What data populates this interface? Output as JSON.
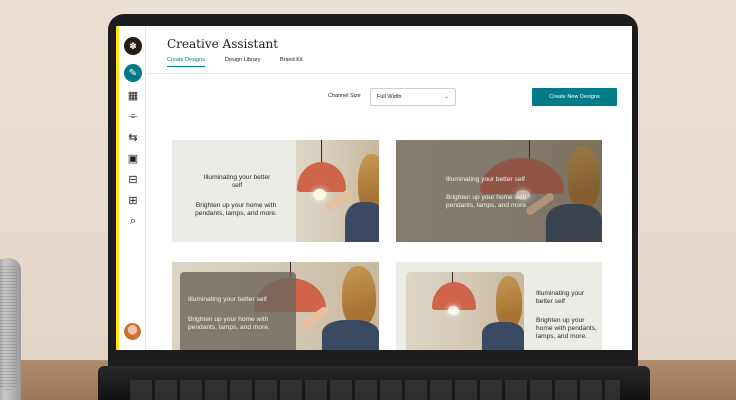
{
  "app": {
    "title": "Creative Assistant",
    "logo_glyph": "✽"
  },
  "tabs": [
    {
      "label": "Create Designs",
      "active": true
    },
    {
      "label": "Design Library",
      "active": false
    },
    {
      "label": "Brand Kit",
      "active": false
    }
  ],
  "controls": {
    "channel_size_label": "Channel Size",
    "channel_size_value": "Full Width",
    "create_button_label": "Create New Designs"
  },
  "sidebar_icons": [
    {
      "name": "pencil-icon",
      "glyph": "✎",
      "active": true
    },
    {
      "name": "campaigns-icon",
      "glyph": "▦"
    },
    {
      "name": "tag-icon",
      "glyph": "⌯"
    },
    {
      "name": "automation-icon",
      "glyph": "⇆"
    },
    {
      "name": "calendar-icon",
      "glyph": "▣"
    },
    {
      "name": "content-icon",
      "glyph": "⊟"
    },
    {
      "name": "grid-icon",
      "glyph": "⊞"
    },
    {
      "name": "search-icon",
      "glyph": "⌕"
    }
  ],
  "designs": [
    {
      "headline": "Illuminating your better self",
      "body": "Brighten up your home with pendants, lamps, and more."
    },
    {
      "headline": "Illuminating your better self",
      "body": "Brighten up your home with pendants, lamps, and more."
    },
    {
      "headline": "Illuminating your better self",
      "body": "Brighten up your home with pendants, lamps, and more."
    },
    {
      "headline": "Illuminating your better self",
      "body": "Brighten up your home with pendants, lamps, and more."
    }
  ],
  "colors": {
    "accent": "#007c89",
    "sidebar_highlight": "#ffe01b",
    "lamp": "#d0644a"
  }
}
